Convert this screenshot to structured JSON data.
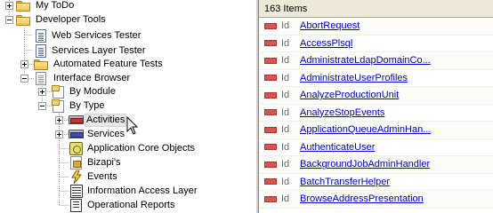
{
  "tree": {
    "nodes": [
      {
        "label": "My ToDo",
        "icon": "folder-icon"
      },
      {
        "label": "Developer Tools",
        "icon": "folder-icon"
      },
      {
        "label": "Web Services Tester",
        "icon": "document-icon"
      },
      {
        "label": "Services Layer Tester",
        "icon": "document-icon"
      },
      {
        "label": "Automated Feature Tests",
        "icon": "folder-icon"
      },
      {
        "label": "Interface Browser",
        "icon": "interface-browser-icon"
      },
      {
        "label": "By Module",
        "icon": "module-doc-icon"
      },
      {
        "label": "By Type",
        "icon": "module-doc-icon"
      },
      {
        "label": "Activities",
        "icon": "activity-icon",
        "selected": true
      },
      {
        "label": "Services",
        "icon": "service-icon"
      },
      {
        "label": "Application Core Objects",
        "icon": "core-object-icon"
      },
      {
        "label": "Bizapi's",
        "icon": "bizapi-icon"
      },
      {
        "label": "Events",
        "icon": "lightning-icon"
      },
      {
        "label": "Information Access Layer",
        "icon": "information-access-icon"
      },
      {
        "label": "Operational Reports",
        "icon": "report-icon"
      }
    ]
  },
  "list": {
    "header": "163 Items",
    "type_label": "Id",
    "row_icon": "activity-icon",
    "rows": [
      "AbortRequest",
      "AccessPlsql",
      "AdministrateLdapDomainCo...",
      "AdministrateUserProfiles",
      "AnalyzeProductionUnit",
      "AnalyzeStopEvents",
      "ApplicationQueueAdminHan...",
      "AuthenticateUser",
      "BackgroundJobAdminHandler",
      "BatchTransferHelper",
      "BrowseAddressPresentation"
    ]
  },
  "colors": {
    "link": "#0000cc",
    "header_bg": "#ece9d8",
    "selection_bg": "#e8e8e8",
    "activity_red": "#c83232"
  }
}
